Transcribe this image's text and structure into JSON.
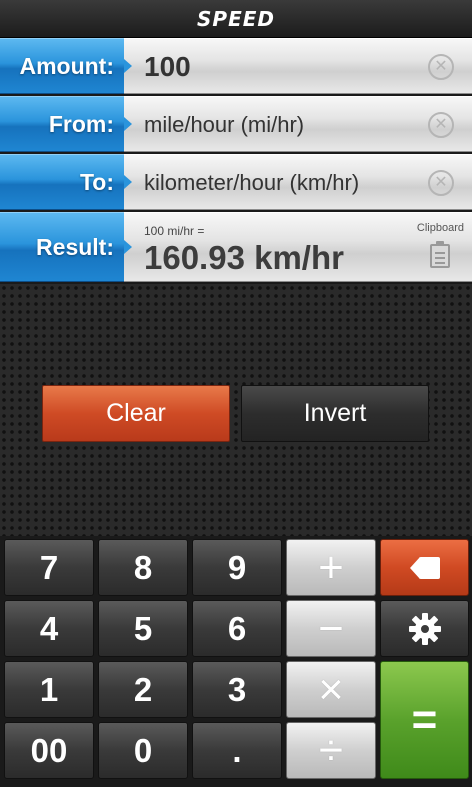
{
  "app": {
    "title": "SPEED"
  },
  "fields": {
    "amount": {
      "label": "Amount:",
      "value": "100"
    },
    "from": {
      "label": "From:",
      "value": "mile/hour (mi/hr)"
    },
    "to": {
      "label": "To:",
      "value": "kilometer/hour (km/hr)"
    },
    "result": {
      "label": "Result:",
      "expression": "100 mi/hr =",
      "value": "160.93 km/hr",
      "clipboard_label": "Clipboard"
    }
  },
  "actions": {
    "clear": "Clear",
    "invert": "Invert"
  },
  "keypad": {
    "k7": "7",
    "k8": "8",
    "k9": "9",
    "k4": "4",
    "k5": "5",
    "k6": "6",
    "k1": "1",
    "k2": "2",
    "k3": "3",
    "k00": "00",
    "k0": "0",
    "dot": ".",
    "plus": "+",
    "minus": "−",
    "times": "×",
    "divide": "÷",
    "equals": "="
  },
  "colors": {
    "label_blue": "#2a94dc",
    "clear_orange": "#cf4b25",
    "equals_green": "#5aa22c"
  },
  "icons": {
    "clear_field": "close-circle-icon",
    "clipboard": "clipboard-icon",
    "backspace": "backspace-icon",
    "settings": "gear-icon"
  }
}
